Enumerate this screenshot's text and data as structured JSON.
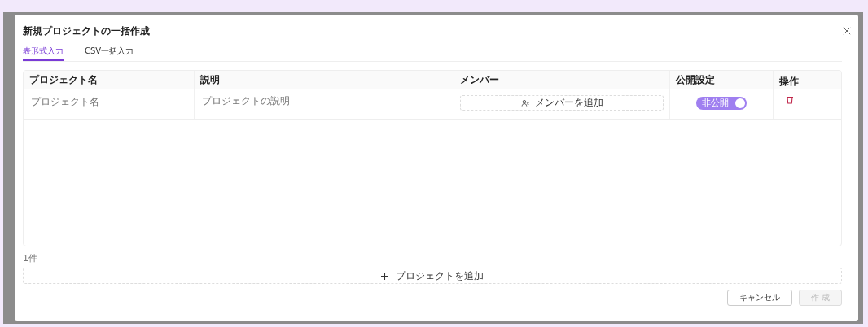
{
  "dialog": {
    "title": "新規プロジェクトの一括作成"
  },
  "tabs": [
    {
      "label": "表形式入力",
      "selected": true
    },
    {
      "label": "CSV一括入力",
      "selected": false
    }
  ],
  "table": {
    "columns": [
      "プロジェクト名",
      "説明",
      "メンバー",
      "公開設定",
      "操作"
    ],
    "rows": [
      {
        "name": {
          "placeholder": "プロジェクト名"
        },
        "description": {
          "placeholder": "プロジェクトの説明"
        },
        "members_button": "メンバーを追加",
        "visibility": {
          "label": "非公開",
          "on": true
        }
      }
    ]
  },
  "count": "1件",
  "add_button": "プロジェクトを追加",
  "buttons": [
    {
      "label": "キャンセル",
      "disabled": false
    },
    {
      "label": "作 成",
      "disabled": true
    }
  ]
}
